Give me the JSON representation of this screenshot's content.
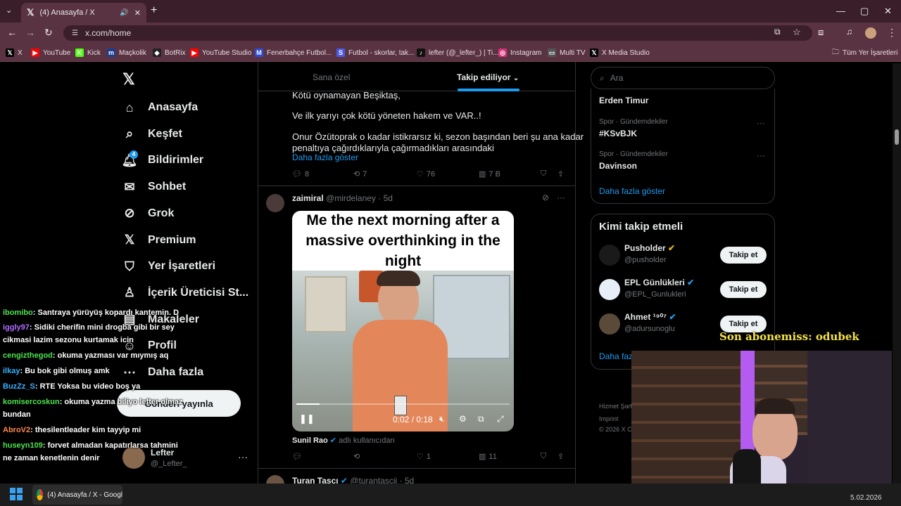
{
  "browser": {
    "tab_title": "(4) Anasayfa / X",
    "url": "x.com/home",
    "bookmarks": [
      {
        "label": "X",
        "icon": "x-icon"
      },
      {
        "label": "YouTube",
        "icon": "youtube-icon"
      },
      {
        "label": "Kick",
        "icon": "kick-icon"
      },
      {
        "label": "Maçkolik",
        "icon": "mackolik-icon"
      },
      {
        "label": "BotRix",
        "icon": "botrix-icon"
      },
      {
        "label": "YouTube Studio",
        "icon": "youtube-icon"
      },
      {
        "label": "Fenerbahçe Futbol...",
        "icon": "m-icon"
      },
      {
        "label": "Futbol - skorlar, tak...",
        "icon": "s-icon"
      },
      {
        "label": "lefter (@_lefter_) | Ti...",
        "icon": "tiktok-icon"
      },
      {
        "label": "Instagram",
        "icon": "instagram-icon"
      },
      {
        "label": "Multi TV",
        "icon": "tv-icon"
      },
      {
        "label": "X Media Studio",
        "icon": "x-icon"
      }
    ],
    "all_bookmarks": "Tüm Yer İşaretleri"
  },
  "nav": {
    "items": [
      {
        "label": "Anasayfa",
        "icon": "home-icon"
      },
      {
        "label": "Keşfet",
        "icon": "search-icon"
      },
      {
        "label": "Bildirimler",
        "icon": "bell-icon",
        "badge": "4"
      },
      {
        "label": "Sohbet",
        "icon": "mail-icon"
      },
      {
        "label": "Grok",
        "icon": "grok-icon"
      },
      {
        "label": "Premium",
        "icon": "x-icon"
      },
      {
        "label": "Yer İşaretleri",
        "icon": "bookmark-icon"
      },
      {
        "label": "İçerik Üreticisi St...",
        "icon": "creator-icon"
      },
      {
        "label": "Makaleler",
        "icon": "article-icon"
      },
      {
        "label": "Profil",
        "icon": "profile-icon"
      },
      {
        "label": "Daha fazla",
        "icon": "more-icon"
      }
    ],
    "post_button": "Gönderi yayınla",
    "account": {
      "name": "Lefter",
      "handle": "@_Lefter_"
    }
  },
  "timeline": {
    "tabs": [
      "Sana özel",
      "Takip ediliyor"
    ],
    "post1": {
      "lines": [
        "Kötü oynamayan Beşiktaş,",
        "Ve ilk yarıyı çok kötü yöneten hakem ve VAR..!",
        "Onur Özütoprak o kadar istikrarsız ki, sezon başından beri şu ana kadar",
        "penaltıya çağırdıklarıyla çağırmadıkları arasındaki"
      ],
      "show_more": "Daha fazla göster",
      "replies": "8",
      "reposts": "7",
      "likes": "76",
      "views": "7 B"
    },
    "post2": {
      "name": "zaimiral",
      "handle": "@mirdelaney",
      "time": "· 5d",
      "meme_caption": "Me the next morning after a massive overthinking in the night",
      "video_time": "0:02 / 0:18",
      "video_progress": 0.11,
      "credit_name": "Sunil Rao",
      "credit_suffix": "adlı kullanıcıdan",
      "replies": "",
      "reposts": "",
      "likes": "1",
      "views": "11"
    },
    "post3": {
      "name": "Turan Taşçı",
      "handle": "@turantascii",
      "time": "· 5d"
    }
  },
  "right": {
    "search_placeholder": "Ara",
    "trends": [
      {
        "category": "",
        "title": "Erden Timur"
      },
      {
        "category": "Spor · Gündemdekiler",
        "title": "#KSvBJK"
      },
      {
        "category": "Spor · Gündemdekiler",
        "title": "Davinson"
      }
    ],
    "trends_more": "Daha fazla göster",
    "who_to_follow_title": "Kimi takip etmeli",
    "suggestions": [
      {
        "name": "Pusholder",
        "handle": "@pusholder",
        "badge": "gold"
      },
      {
        "name": "EPL Günlükleri",
        "handle": "@EPL_Gunlukleri",
        "badge": "blue"
      },
      {
        "name": "Ahmet ¹⁹⁰⁷",
        "handle": "@adursunoglu",
        "badge": "blue"
      }
    ],
    "follow_label": "Takip et",
    "more_partial": "Daha fazl",
    "footer": [
      "Hizmet Şart",
      "Imprint",
      "© 2026 X C"
    ]
  },
  "overlay": {
    "last_sub": "Son abonemiss: odubek",
    "chat": [
      {
        "user": "ibomibo",
        "msg": ": Santraya yürüyüş kopardı kantemin. D"
      },
      {
        "user": "iggly97",
        "msg": ": Sidiki cherifin mini drogba gibi bir sey"
      },
      {
        "user": "",
        "msg": "cikmasi lazim sezonu kurtamak icin"
      },
      {
        "user": "cengizthegod",
        "msg": ": okuma yazması var mıymış aq"
      },
      {
        "user": "ilkay",
        "msg": ": Bu bok gibi olmuş amk"
      },
      {
        "user": "BuzZz_S",
        "msg": ": RTE Yoksa bu video boş ya"
      },
      {
        "user": "komisercoskun",
        "msg": ": okuma yazma biliyo lefter olmaz"
      },
      {
        "user": "",
        "msg": "bundan"
      },
      {
        "user": "AbroV2",
        "msg": ": thesilentleader kim tayyip mi"
      },
      {
        "user": "huseyn109",
        "msg": ": forvet almadan kapatırlarsa tahmini"
      },
      {
        "user": "",
        "msg": "ne zaman kenetlenin denir"
      }
    ]
  },
  "taskbar": {
    "app_title": "(4) Anasayfa / X - Googl",
    "date": "5.02.2026"
  }
}
